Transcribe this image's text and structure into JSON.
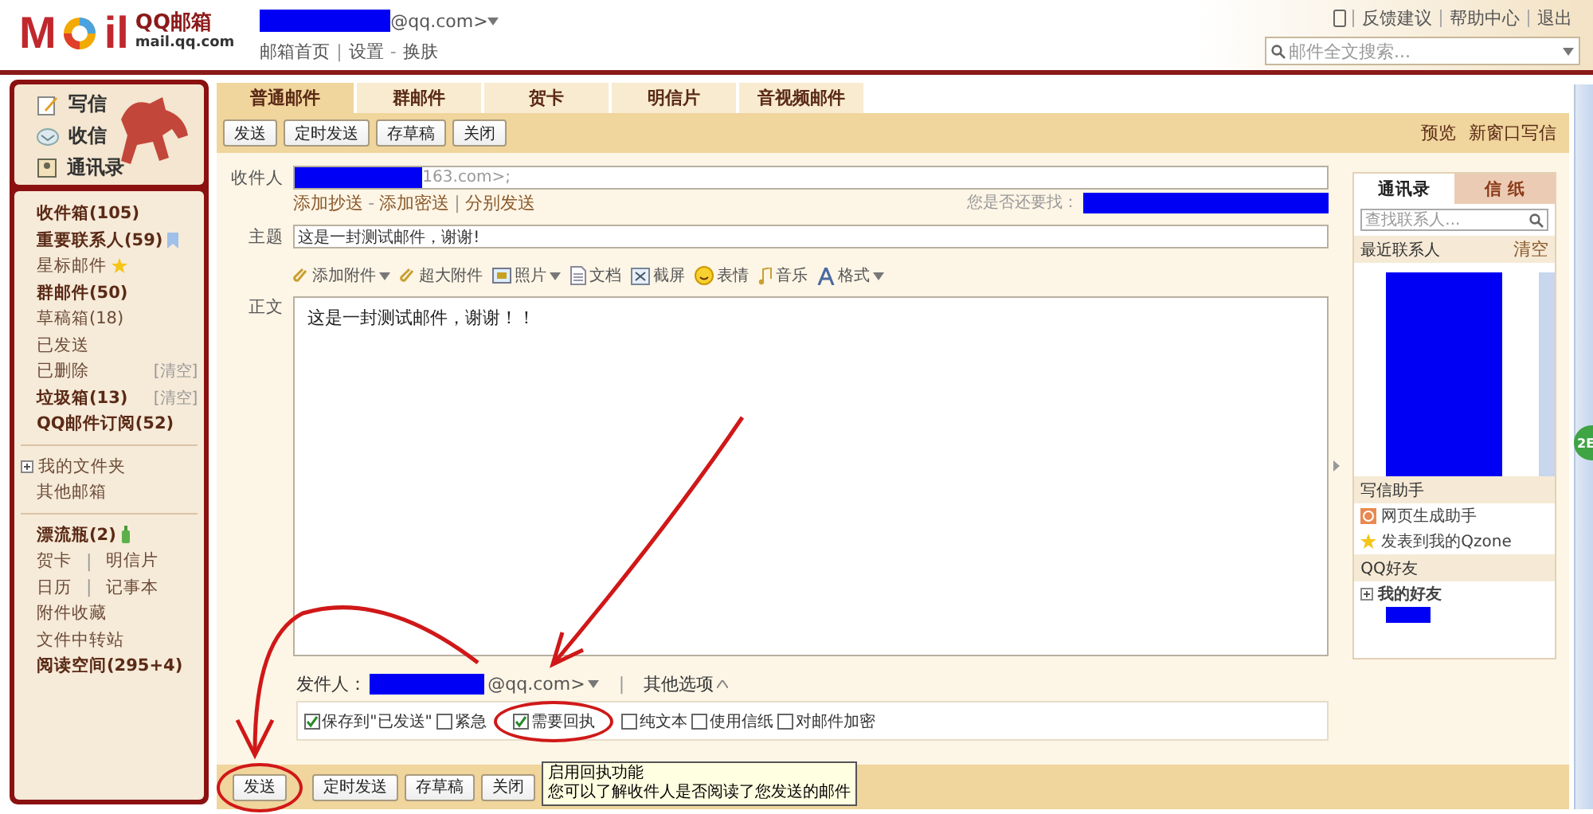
{
  "logo": {
    "letters_left": "M",
    "letters_right": "il",
    "name": "QQ邮箱",
    "domain": "mail.qq.com"
  },
  "account": {
    "address_tail": "@qq.com>",
    "links": [
      {
        "label": "邮箱首页"
      },
      {
        "sep": "|",
        "label": "设置"
      },
      {
        "sep": "-",
        "label": "换肤"
      }
    ]
  },
  "top_links": [
    "反馈建议",
    "帮助中心",
    "退出"
  ],
  "search": {
    "placeholder": "邮件全文搜索..."
  },
  "sidebar": {
    "quick": [
      "写信",
      "收信",
      "通讯录"
    ],
    "groups": [
      [
        {
          "kind": "folder",
          "label": "收件箱(105)",
          "bold": true
        },
        {
          "kind": "folder",
          "label": "重要联系人(59)",
          "bold": true
        },
        {
          "kind": "folder",
          "label": "星标邮件",
          "bold": false
        },
        {
          "kind": "folder",
          "label": "群邮件(50)",
          "bold": true
        },
        {
          "kind": "folder",
          "label": "草稿箱(18)",
          "bold": false
        },
        {
          "kind": "folder",
          "label": "已发送",
          "bold": false
        },
        {
          "kind": "folder",
          "label": "已删除",
          "bold": false,
          "action": "[清空]"
        },
        {
          "kind": "folder",
          "label": "垃圾箱(13)",
          "bold": true,
          "action": "[清空]"
        },
        {
          "kind": "folder",
          "label": "QQ邮件订阅(52)",
          "bold": true
        }
      ],
      [
        {
          "kind": "tree",
          "label": "我的文件夹",
          "expanded": false
        },
        {
          "kind": "folder",
          "label": "其他邮箱",
          "bold": false
        }
      ],
      [
        {
          "kind": "folder",
          "label": "漂流瓶(2)",
          "bold": true
        },
        {
          "kind": "pair",
          "labels": [
            "贺卡",
            "明信片"
          ],
          "sep": "|"
        },
        {
          "kind": "pair",
          "labels": [
            "日历",
            "记事本"
          ],
          "sep": "|"
        },
        {
          "kind": "folder",
          "label": "附件收藏",
          "bold": false
        },
        {
          "kind": "folder",
          "label": "文件中转站",
          "bold": false
        },
        {
          "kind": "folder",
          "label": "阅读空间(295+4)",
          "bold": true
        }
      ]
    ]
  },
  "tabs": [
    {
      "label": "普通邮件",
      "selected": true
    },
    {
      "label": "群邮件",
      "selected": false
    },
    {
      "label": "贺卡",
      "selected": false
    },
    {
      "label": "明信片",
      "selected": false
    },
    {
      "label": "音视频邮件",
      "selected": false
    }
  ],
  "toolbar": {
    "buttons": [
      "发送",
      "定时发送",
      "存草稿",
      "关闭"
    ],
    "links": [
      "预览",
      "新窗口写信"
    ]
  },
  "compose": {
    "recipient": {
      "label": "收件人",
      "value_tail": "163.com>;",
      "links": [
        {
          "label": "添加抄送"
        },
        {
          "sep": "-",
          "label": "添加密送"
        },
        {
          "sep": "|",
          "label": "分别发送"
        }
      ],
      "hint": "您是否还要找："
    },
    "subject": {
      "label": "主题",
      "value": "这是一封测试邮件，谢谢!"
    },
    "attach_tools": [
      {
        "label": "添加附件",
        "dropdown": true
      },
      {
        "label": "超大附件",
        "dropdown": false
      },
      {
        "label": "照片",
        "dropdown": true
      },
      {
        "label": "文档",
        "dropdown": false
      },
      {
        "label": "截屏",
        "dropdown": false
      },
      {
        "label": "表情",
        "dropdown": false
      },
      {
        "label": "音乐",
        "dropdown": false
      },
      {
        "label": "格式",
        "dropdown": true
      }
    ],
    "body": {
      "label": "正文",
      "value": "这是一封测试邮件，谢谢！！"
    },
    "sender": {
      "label": "发件人：",
      "address_tail": "@qq.com>",
      "divider": "|",
      "more": "其他选项",
      "more_expanded": true
    },
    "options": [
      {
        "label": "保存到\"已发送\"",
        "checked": true
      },
      {
        "label": "紧急",
        "checked": false
      },
      {
        "label": "需要回执",
        "checked": true
      },
      {
        "label": "纯文本",
        "checked": false
      },
      {
        "label": "使用信纸",
        "checked": false
      },
      {
        "label": "对邮件加密",
        "checked": false
      }
    ],
    "tooltip": [
      "启用回执功能",
      "您可以了解收件人是否阅读了您发送的邮件"
    ]
  },
  "bottom_buttons": [
    "发送",
    "定时发送",
    "存草稿",
    "关闭"
  ],
  "contacts_panel": {
    "tabs": [
      {
        "label": "通讯录",
        "selected": true
      },
      {
        "label": "信 纸",
        "selected": false
      }
    ],
    "search": {
      "placeholder": "查找联系人..."
    },
    "recent": {
      "title": "最近联系人",
      "action": "清空"
    },
    "helper": {
      "title": "写信助手",
      "items": [
        "网页生成助手",
        "发表到我的Qzone"
      ]
    },
    "friends": {
      "title": "QQ好友",
      "groups": [
        {
          "label": "我的好友",
          "expanded": false
        }
      ]
    }
  },
  "float_badge": "2E"
}
